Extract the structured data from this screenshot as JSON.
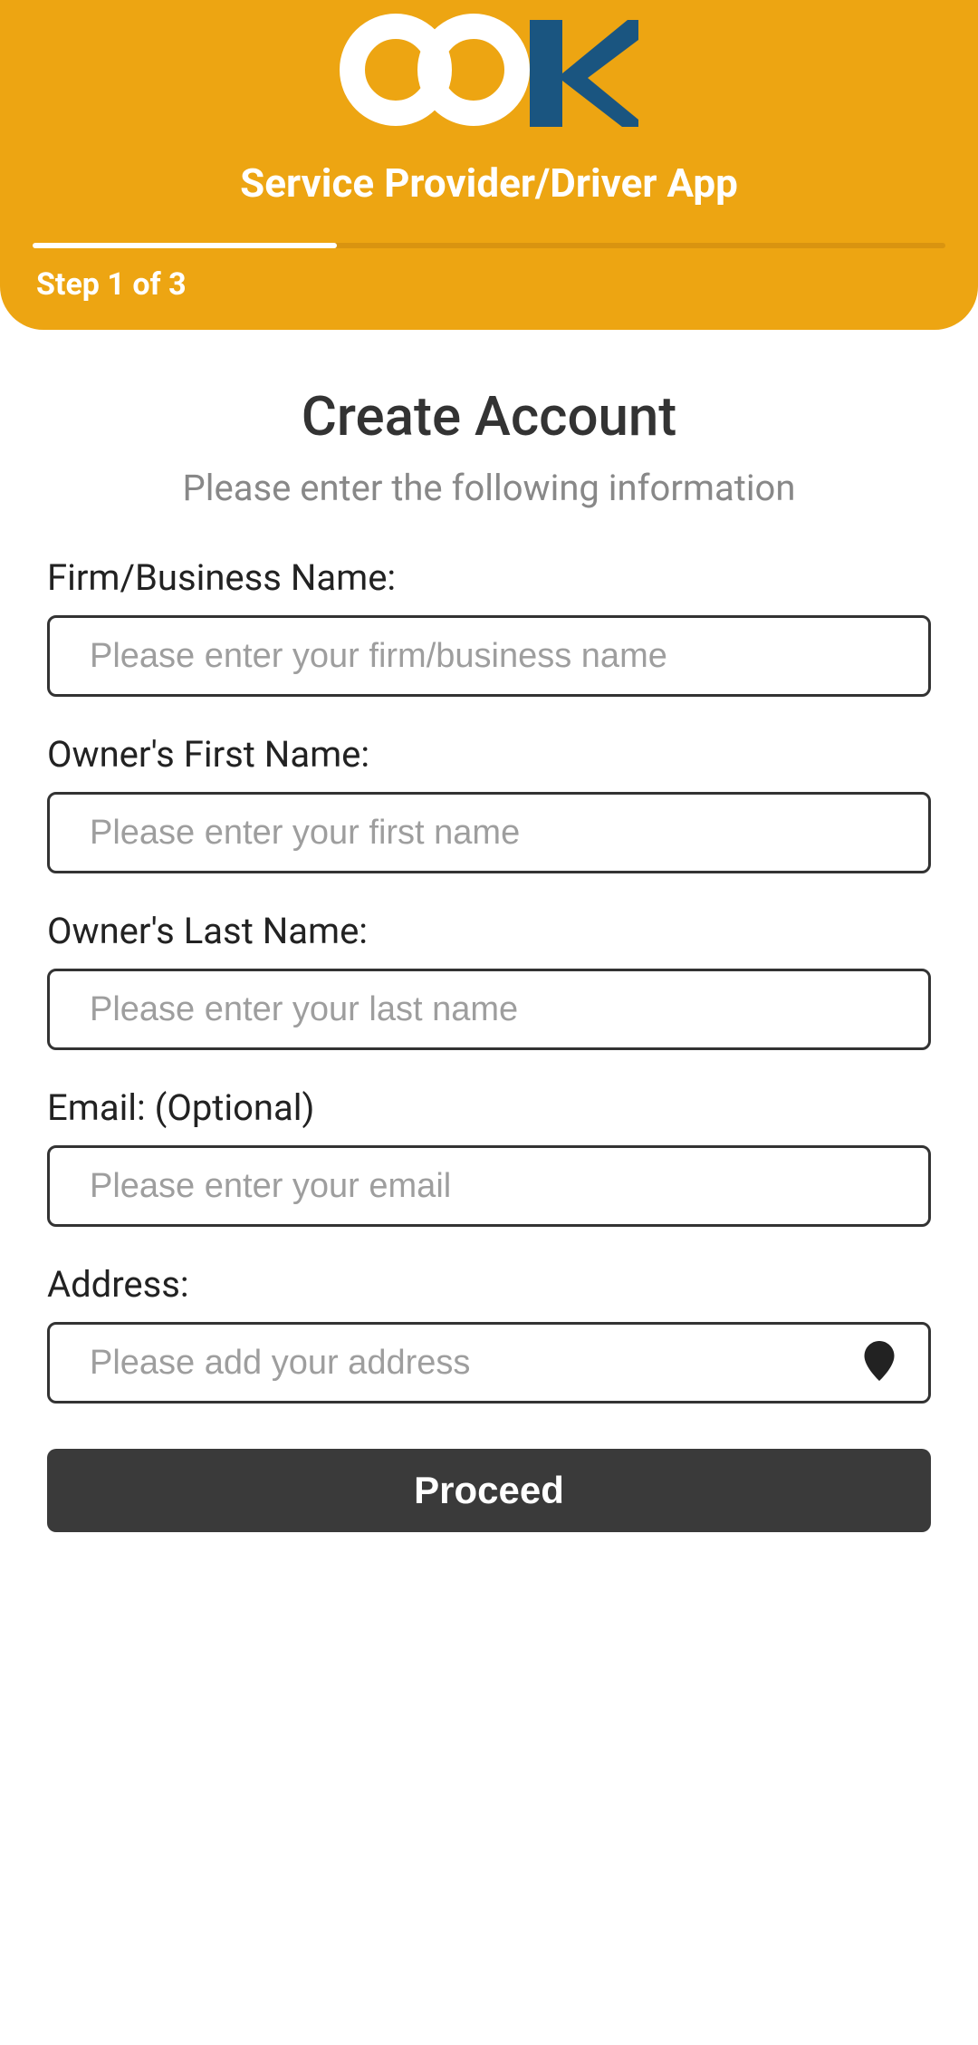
{
  "header": {
    "subtitle": "Service Provider/Driver App",
    "step_text": "Step 1 of 3",
    "progress_percent": 33.33
  },
  "main": {
    "title": "Create Account",
    "description": "Please enter the following information"
  },
  "fields": {
    "business": {
      "label": "Firm/Business Name:",
      "placeholder": "Please enter your firm/business name",
      "value": ""
    },
    "first_name": {
      "label": "Owner's First Name:",
      "placeholder": "Please enter your first name",
      "value": ""
    },
    "last_name": {
      "label": "Owner's Last Name:",
      "placeholder": "Please enter your last name",
      "value": ""
    },
    "email": {
      "label": "Email: (Optional)",
      "placeholder": "Please enter your email",
      "value": ""
    },
    "address": {
      "label": "Address:",
      "placeholder": "Please add your address",
      "value": ""
    }
  },
  "buttons": {
    "proceed": "Proceed"
  },
  "colors": {
    "accent": "#eda512",
    "dark": "#3a3a3a",
    "logo_blue": "#1a5580"
  }
}
